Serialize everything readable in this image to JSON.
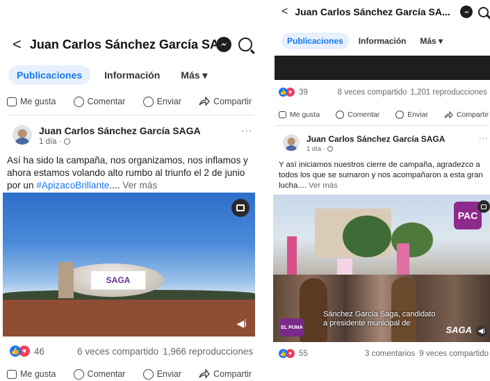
{
  "left": {
    "header": {
      "back": "<",
      "title": "Juan Carlos Sánchez García SA..."
    },
    "tabs": [
      "Publicaciones",
      "Información",
      "Más ▾"
    ],
    "actions": [
      "Me gusta",
      "Comentar",
      "Enviar",
      "Compartir"
    ],
    "post": {
      "author": "Juan Carlos Sánchez García SAGA",
      "time": "1 día · ",
      "more": "···",
      "text_1": "Así ha sido la campaña, nos organizamos, nos inflamos y ahora estamos volando alto rumbo al triunfo el 2 de junio por un ",
      "hashtag": "#ApizacoBrillante",
      "text_2": "....",
      "see_more": " Ver más",
      "blimp_text": "SAGA",
      "reactions": "46",
      "shares": "6 veces compartido",
      "views": "1,966 reproducciones"
    },
    "bottom_actions": [
      "Me gusta",
      "Comentar",
      "Enviar",
      "Compartir"
    ]
  },
  "right": {
    "header": {
      "back": "<",
      "title": "Juan Carlos Sánchez García SA..."
    },
    "tabs": [
      "Publicaciones",
      "Información",
      "Más ▾"
    ],
    "prev_stats": {
      "reactions": "39",
      "shares": "8 veces compartido",
      "views": "1,201 reproducciones"
    },
    "actions": [
      "Me gusta",
      "Comentar",
      "Enviar",
      "Compartir"
    ],
    "post": {
      "author": "Juan Carlos Sánchez García SAGA",
      "time": "1 día · ",
      "more": "···",
      "text": "Y así iniciamos nuestros cierre de campaña, agradezco a todos los que se sumaron y nos acompañaron a esta gran lucha....",
      "see_more": " Ver más",
      "caption_1": "Sánchez García Saga, candidato",
      "caption_2": "a presidente municipal de",
      "logo": "PAC",
      "watermark": "SAGA",
      "badge": "EL PUMA",
      "reactions": "55",
      "comments": "3 comentarios",
      "shares": "9 veces compartido"
    }
  },
  "colors": {
    "accent": "#1877f2",
    "love": "#f33e58",
    "tab_bg": "#e7f0fd"
  }
}
